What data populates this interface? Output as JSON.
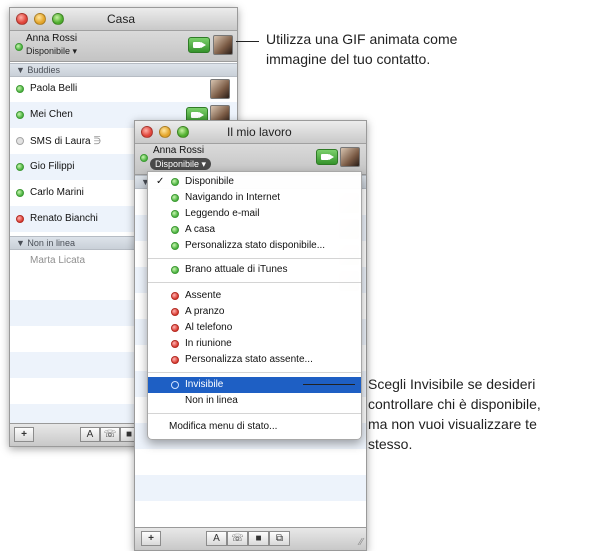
{
  "casa_window": {
    "title": "Casa",
    "user": {
      "name": "Anna Rossi",
      "status": "Disponibile"
    },
    "group_buddies": "Buddies",
    "buddies": [
      {
        "name": "Paola Belli",
        "status": "green"
      },
      {
        "name": "Mei Chen",
        "status": "green"
      },
      {
        "name": "SMS di Laura",
        "status": "gray",
        "extra": "signal-icon"
      },
      {
        "name": "Gio Filippi",
        "status": "green"
      },
      {
        "name": "Carlo Marini",
        "status": "green"
      },
      {
        "name": "Renato Bianchi",
        "status": "red"
      }
    ],
    "group_offline": "Non in linea",
    "offline": [
      {
        "name": "Marta Licata"
      }
    ],
    "bottom": {
      "add": "+",
      "a": "A"
    }
  },
  "lavoro_window": {
    "title": "Il mio lavoro",
    "user": {
      "name": "Anna Rossi",
      "status": "Disponibile"
    },
    "bottom": {
      "add": "+",
      "a": "A"
    }
  },
  "status_menu": {
    "available": [
      {
        "label": "Disponibile",
        "checked": true
      },
      {
        "label": "Navigando in Internet"
      },
      {
        "label": "Leggendo e-mail"
      },
      {
        "label": "A casa"
      },
      {
        "label": "Personalizza stato disponibile..."
      }
    ],
    "itunes": "Brano attuale di iTunes",
    "away": [
      {
        "label": "Assente"
      },
      {
        "label": "A pranzo"
      },
      {
        "label": "Al telefono"
      },
      {
        "label": "In riunione"
      },
      {
        "label": "Personalizza stato assente..."
      }
    ],
    "invisible": "Invisibile",
    "offline": "Non in linea",
    "edit": "Modifica menu di stato..."
  },
  "callouts": {
    "top": [
      "Utilizza una GIF animata come",
      "immagine del tuo contatto."
    ],
    "bottom": [
      "Scegli Invisibile se desideri",
      "controllare chi è disponibile,",
      "ma non vuoi visualizzare te",
      "stesso."
    ]
  },
  "colors": {
    "available": "#49b23e",
    "away": "#d93a2f",
    "selection": "#1e5fc4"
  }
}
